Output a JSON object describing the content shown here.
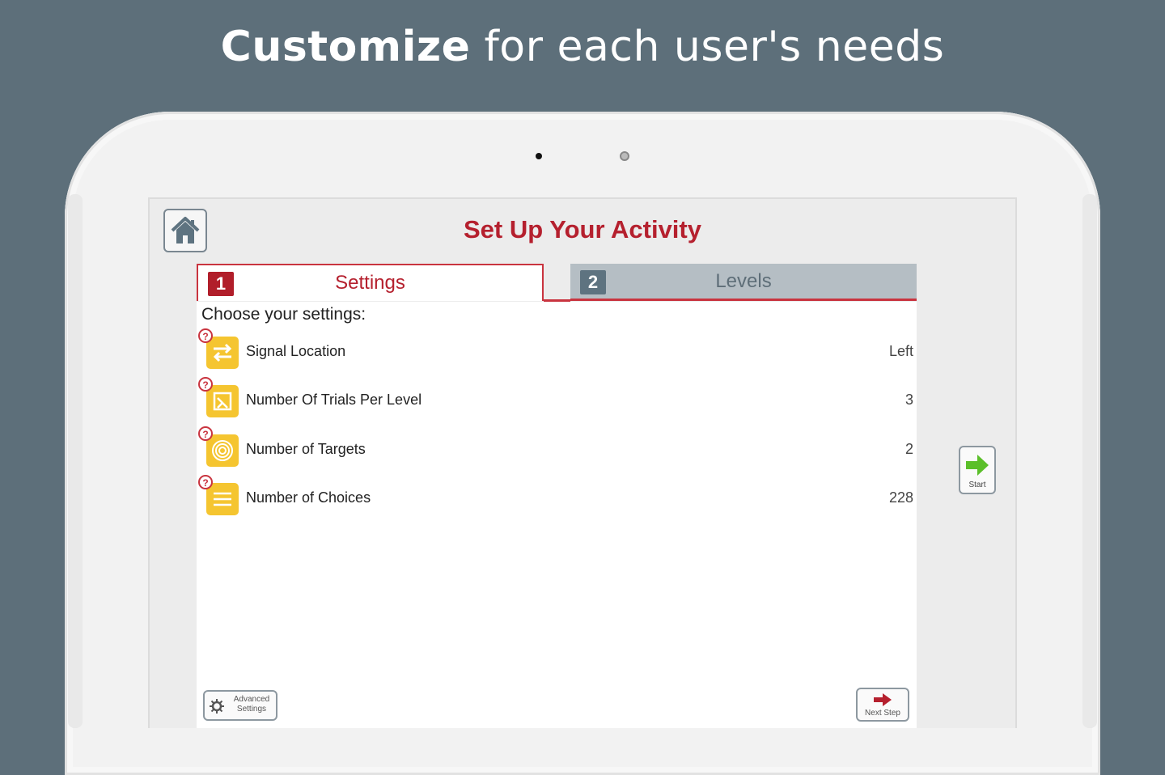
{
  "headline": {
    "bold": "Customize",
    "rest": " for each user's needs"
  },
  "screen": {
    "title": "Set Up Your Activity",
    "tabs": [
      {
        "number": "1",
        "label": "Settings",
        "active": true
      },
      {
        "number": "2",
        "label": "Levels",
        "active": false
      }
    ],
    "choose_label": "Choose your settings:",
    "settings": [
      {
        "label": "Signal Location",
        "value": "Left",
        "icon": "swap-arrows-icon"
      },
      {
        "label": "Number Of Trials Per Level",
        "value": "3",
        "icon": "trials-icon"
      },
      {
        "label": "Number of Targets",
        "value": "2",
        "icon": "target-icon"
      },
      {
        "label": "Number of Choices",
        "value": "228",
        "icon": "list-lines-icon"
      }
    ],
    "start_label": "Start",
    "advanced_label": "Advanced Settings",
    "next_label": "Next Step"
  },
  "colors": {
    "accent_red": "#b5202e",
    "icon_yellow": "#f5c530",
    "background": "#5d6f7a",
    "start_green": "#5bbf2a"
  }
}
